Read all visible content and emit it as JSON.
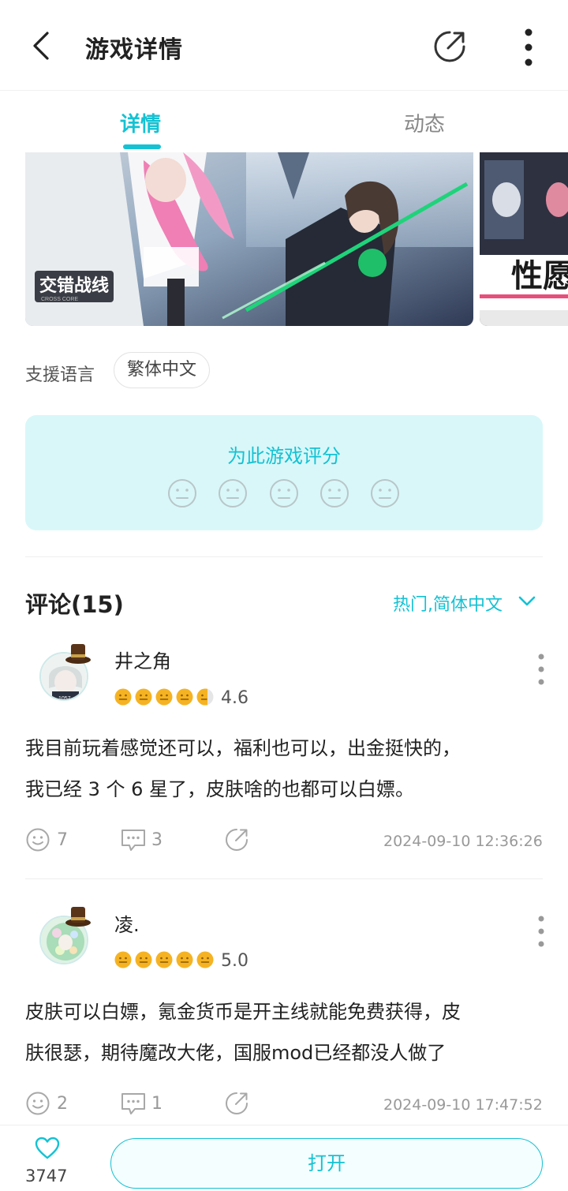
{
  "header": {
    "title": "游戏详情"
  },
  "tabs": [
    {
      "label": "详情"
    },
    {
      "label": "动态"
    }
  ],
  "gallery": {
    "logo_text": "交错战线",
    "logo_sub": "CROSS CORE",
    "shot2_text": "性愿"
  },
  "support_language": {
    "label": "支援语言",
    "value": "繁体中文"
  },
  "rating": {
    "title": "为此游戏评分",
    "faces": 5
  },
  "comments_section": {
    "title": "评论(15)",
    "filter": "热门,简体中文"
  },
  "comments": [
    {
      "name": "井之角",
      "score": "4.6",
      "stars": 4.6,
      "text_line1": "我目前玩着感觉还可以，福利也可以，出金挺快的，",
      "text_line2": "我已经 3 个 6 星了，皮肤啥的也都可以白嫖。",
      "likes": "7",
      "replies": "3",
      "time": "2024-09-10 12:36:26"
    },
    {
      "name": "凌.",
      "score": "5.0",
      "stars": 5.0,
      "text_line1": "皮肤可以白嫖，氪金货币是开主线就能免费获得，皮",
      "text_line2": "肤很瑟，期待魔改大佬，国服mod已经都没人做了",
      "likes": "2",
      "replies": "1",
      "time": "2024-09-10 17:47:52"
    }
  ],
  "bottom": {
    "like_count": "3747",
    "open_label": "打开"
  },
  "colors": {
    "accent": "#14c2d3",
    "star": "#f5b323",
    "rate_bg": "#d9f7f9"
  }
}
